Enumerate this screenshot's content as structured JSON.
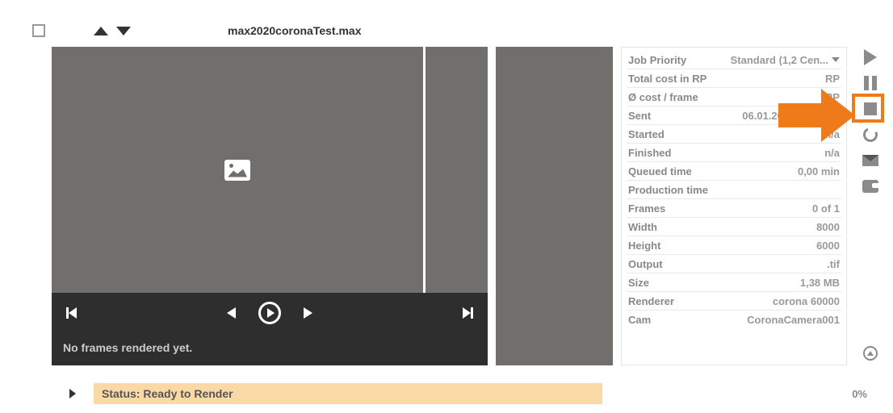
{
  "file": {
    "title": "max2020coronaTest.max"
  },
  "preview": {
    "no_frames_msg": "No frames rendered yet."
  },
  "details": [
    {
      "label": "Job Priority",
      "value": "Standard (1,2 Cen...",
      "dropdown": true
    },
    {
      "label": "Total cost in RP",
      "value": "RP"
    },
    {
      "label": "Ø cost / frame",
      "value": "RP"
    },
    {
      "label": "Sent",
      "value": "06.01.2021 12:25:30"
    },
    {
      "label": "Started",
      "value": "n/a"
    },
    {
      "label": "Finished",
      "value": "n/a"
    },
    {
      "label": "Queued time",
      "value": "0,00 min"
    },
    {
      "label": "Production time",
      "value": ""
    },
    {
      "label": "Frames",
      "value": "0 of 1"
    },
    {
      "label": "Width",
      "value": "8000"
    },
    {
      "label": "Height",
      "value": "6000"
    },
    {
      "label": "Output",
      "value": ".tif"
    },
    {
      "label": "Size",
      "value": "1,38 MB"
    },
    {
      "label": "Renderer",
      "value": "corona 60000"
    },
    {
      "label": "Cam",
      "value": "CoronaCamera001"
    }
  ],
  "status": {
    "label": "Status: Ready to Render",
    "percent": "0%"
  }
}
